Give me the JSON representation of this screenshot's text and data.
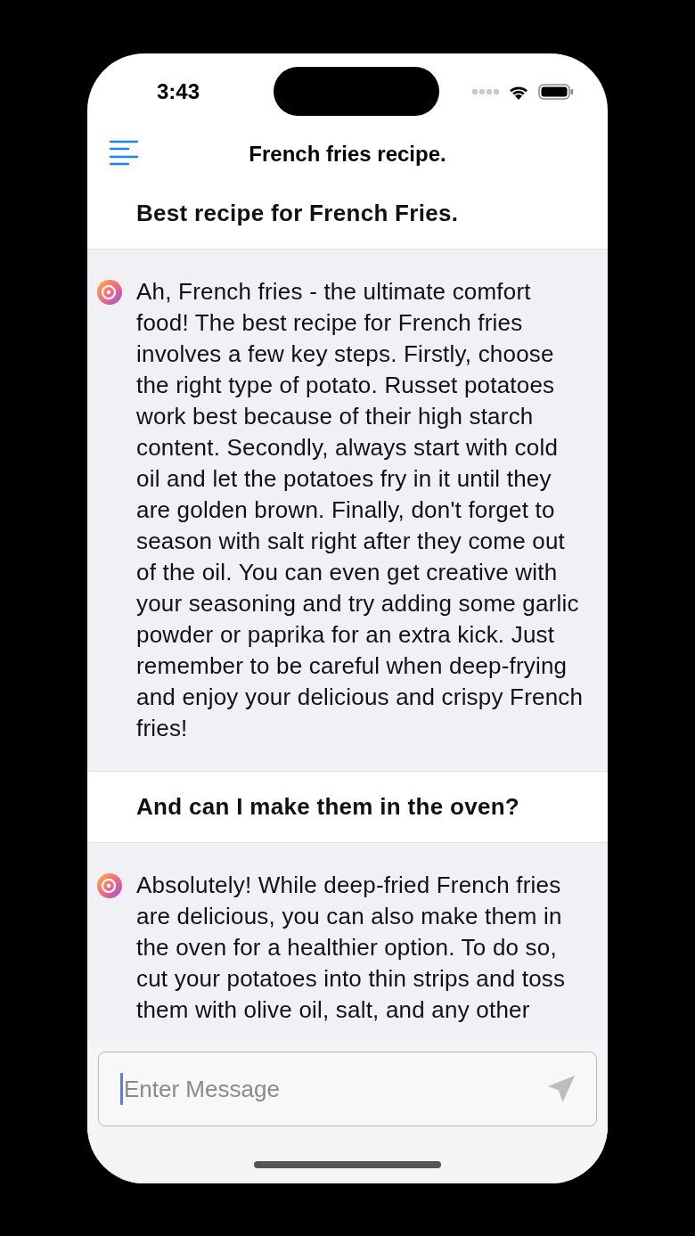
{
  "status_bar": {
    "time": "3:43"
  },
  "nav": {
    "title": "French fries recipe."
  },
  "messages": [
    {
      "kind": "user",
      "text": "Best recipe for French Fries."
    },
    {
      "kind": "bot",
      "text": "Ah, French fries - the ultimate comfort food! The best recipe for French fries involves a few key steps. Firstly, choose the right type of potato. Russet potatoes work best because of their high starch content. Secondly, always start with cold oil and let the potatoes fry in it until they are golden brown. Finally, don't forget to season with salt right after they come out of the oil. You can even get creative with your seasoning and try adding some garlic powder or paprika for an extra kick. Just remember to be careful when deep-frying and enjoy your delicious and crispy French fries!"
    },
    {
      "kind": "user",
      "text": "And can I make them in the oven?"
    },
    {
      "kind": "bot",
      "text": "Absolutely! While deep-fried French fries are delicious, you can also make them in the oven for a healthier option. To do so, cut your potatoes into thin strips and toss them with olive oil, salt, and any other"
    }
  ],
  "composer": {
    "placeholder": "Enter Message"
  }
}
